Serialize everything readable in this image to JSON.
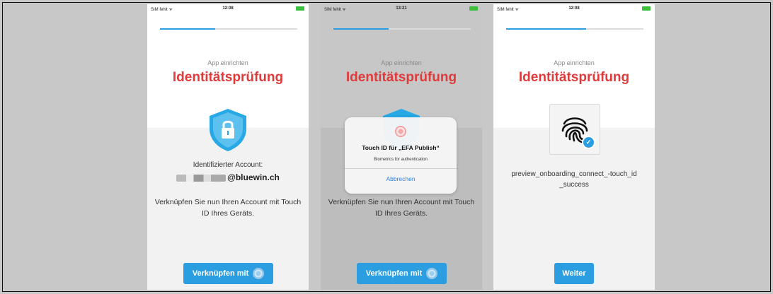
{
  "colors": {
    "brand_red": "#e03b3b",
    "accent_blue": "#2a9ee0",
    "page_bg": "#c8c8c8"
  },
  "screens": [
    {
      "status": {
        "carrier": "SIM fehlt ᯤ",
        "time": "12:08"
      },
      "subtitle": "App einrichten",
      "title": "Identitätsprüfung",
      "icon": "shield-lock-icon",
      "account_label": "Identifizierter Account:",
      "account_value": "@bluewin.ch",
      "description": "Verknüpfen Sie nun Ihren Account mit Touch ID Ihres Geräts.",
      "button_label": "Verknüpfen mit"
    },
    {
      "status": {
        "carrier": "SIM fehlt ᯤ",
        "time": "13:21"
      },
      "subtitle": "App einrichten",
      "title": "Identitätsprüfung",
      "description": "Verknüpfen Sie nun Ihren Account mit Touch ID Ihres Geräts.",
      "button_label": "Verknüpfen mit",
      "dialog": {
        "icon": "fingerprint-icon",
        "title": "Touch ID für „EFA Publish“",
        "subtitle": "Biometrics for authentication",
        "cancel_label": "Abbrechen"
      }
    },
    {
      "status": {
        "carrier": "SIM fehlt ᯤ",
        "time": "12:08"
      },
      "subtitle": "App einrichten",
      "title": "Identitätsprüfung",
      "icon": "fingerprint-check-icon",
      "message": "preview_onboarding_connect_-touch_id_success",
      "button_label": "Weiter"
    }
  ]
}
